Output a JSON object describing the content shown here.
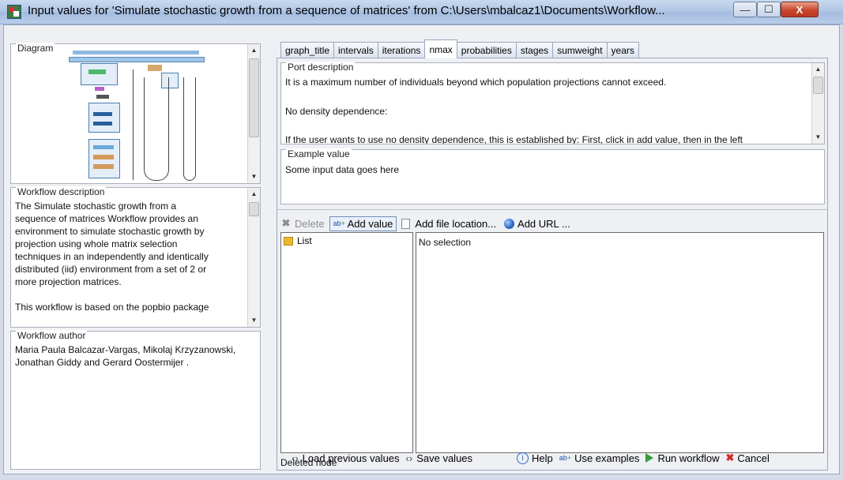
{
  "window": {
    "title": "Input values for 'Simulate stochastic growth from a sequence of matrices' from C:\\Users\\mbalcaz1\\Documents\\Workflow...",
    "controls": {
      "minimize": "—",
      "maximize": "☐",
      "close": "X"
    }
  },
  "left": {
    "diagram_label": "Diagram",
    "workflow_description": {
      "label": "Workflow description",
      "lines": [
        "The Simulate stochastic growth from a",
        "sequence of matrices Workflow provides an",
        "environment to simulate stochastic growth by",
        "projection using whole matrix selection",
        "techniques in an independently and identically",
        "distributed (iid) environment from a set of 2 or",
        "more projection matrices.",
        "",
        "This workflow is based on the popbio package"
      ]
    },
    "workflow_author": {
      "label": "Workflow author",
      "lines": [
        "Maria Paula Balcazar-Vargas, Mikolaj Krzyzanowski,",
        "Jonathan Giddy and Gerard Oostermijer ."
      ]
    }
  },
  "tabs": [
    {
      "label": "graph_title"
    },
    {
      "label": "intervals"
    },
    {
      "label": "iterations"
    },
    {
      "label": "nmax"
    },
    {
      "label": "probabilities"
    },
    {
      "label": "stages"
    },
    {
      "label": "sumweight"
    },
    {
      "label": "years"
    }
  ],
  "active_tab": "nmax",
  "port_description": {
    "label": "Port description",
    "lines": [
      "It is a maximum number of individuals beyond which population projections cannot exceed.",
      "",
      "No density dependence:",
      "",
      "If the user wants to use no density dependence, this is established by: First, click in add value, then in the left"
    ]
  },
  "example_value": {
    "label": "Example value",
    "text": "Some input data goes here"
  },
  "toolbar": {
    "delete": "Delete",
    "add_value": "Add value",
    "add_file_location": "Add file location...",
    "add_url": "Add URL ..."
  },
  "tree": {
    "root_label": "List"
  },
  "detail": {
    "text": "No selection"
  },
  "status": {
    "text": "Deleted node"
  },
  "bottom": {
    "load_previous": "Load previous values",
    "save_values": "Save values",
    "help": "Help",
    "use_examples": "Use examples",
    "run_workflow": "Run workflow",
    "cancel": "Cancel"
  },
  "colors": {
    "accent_green": "#3a9a3a",
    "cancel_red": "#d12a2a",
    "folder_yellow": "#e8b830",
    "help_blue": "#2a62c7"
  }
}
